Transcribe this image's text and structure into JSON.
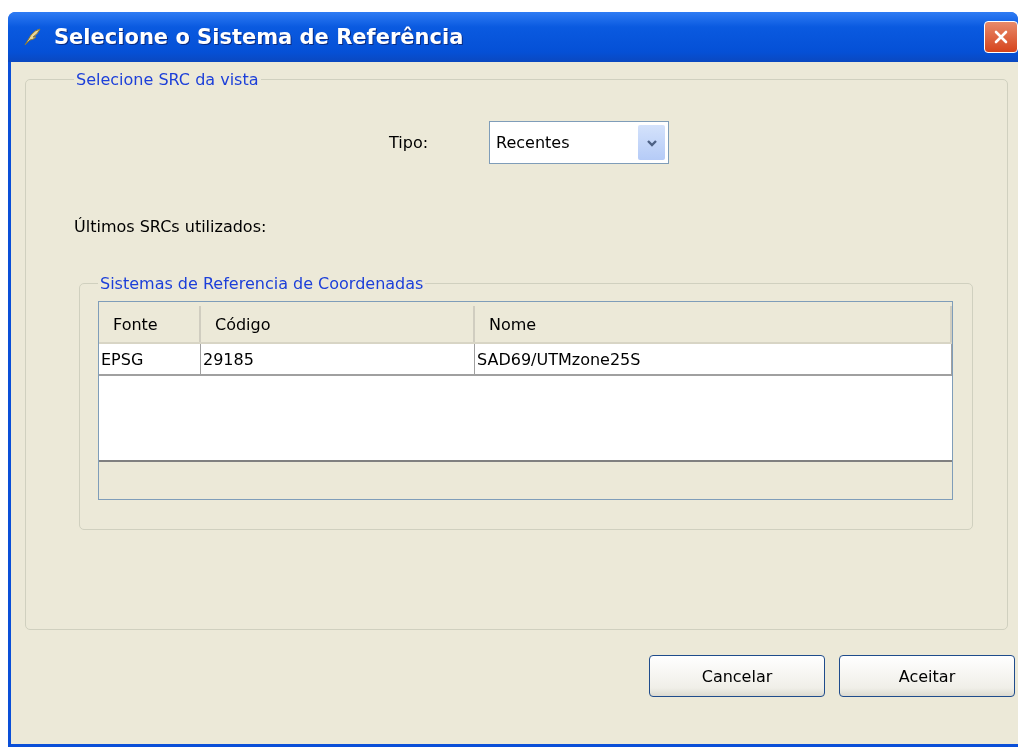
{
  "window": {
    "title": "Selecione o Sistema de Referência"
  },
  "view_group": {
    "legend": "Selecione SRC da vista",
    "type_label": "Tipo:",
    "type_value": "Recentes",
    "recent_label": "Últimos SRCs utilizados:"
  },
  "crs_group": {
    "legend": "Sistemas de Referencia de Coordenadas",
    "table": {
      "columns": [
        "Fonte",
        "Código",
        "Nome"
      ],
      "rows": [
        [
          "EPSG",
          "29185",
          "SAD69/UTMzone25S"
        ]
      ]
    }
  },
  "buttons": [
    "Cancelar",
    "Aceitar"
  ]
}
